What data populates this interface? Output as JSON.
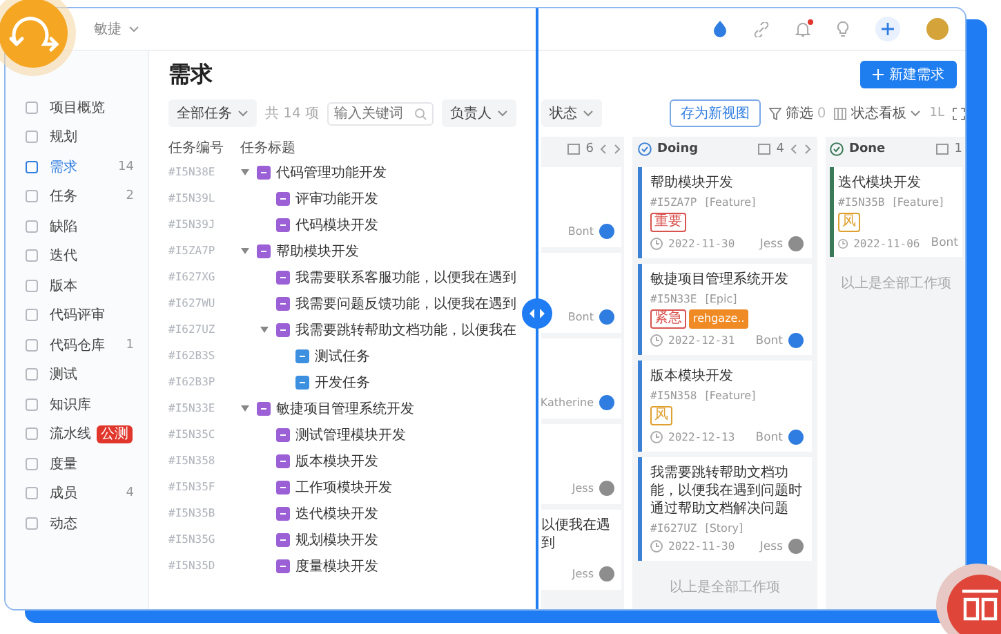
{
  "header": {
    "project": "敏捷",
    "notification": true
  },
  "sidebar": {
    "items": [
      {
        "label": "项目概览",
        "selected": false
      },
      {
        "label": "规划",
        "selected": false
      },
      {
        "label": "需求",
        "count": "14",
        "selected": true
      },
      {
        "label": "任务",
        "count": "2",
        "selected": false
      },
      {
        "label": "缺陷",
        "selected": false
      },
      {
        "label": "迭代",
        "selected": false
      },
      {
        "label": "版本",
        "selected": false
      },
      {
        "label": "代码评审",
        "selected": false
      },
      {
        "label": "代码仓库",
        "count": "1",
        "selected": false
      },
      {
        "label": "测试",
        "selected": false
      },
      {
        "label": "知识库",
        "selected": false
      },
      {
        "label": "流水线",
        "badge": "公测",
        "selected": false
      },
      {
        "label": "度量",
        "selected": false
      },
      {
        "label": "成员",
        "count": "4",
        "selected": false
      },
      {
        "label": "动态",
        "selected": false
      }
    ]
  },
  "page": {
    "title": "需求",
    "new_button": "新建需求"
  },
  "list_view": {
    "toolbar": {
      "scope": "全部任务",
      "total": "共 14 项",
      "search_placeholder": "输入关键词",
      "assignee": "负责人"
    },
    "columns": [
      "任务编号",
      "任务标题"
    ],
    "rows": [
      {
        "id": "#I5N38E",
        "title": "代码管理功能开发",
        "kind": "requirement",
        "expanded": true,
        "children": [
          {
            "id": "#I5N39L",
            "title": "评审功能开发",
            "kind": "requirement"
          },
          {
            "id": "#I5N39J",
            "title": "代码模块开发",
            "kind": "requirement"
          }
        ]
      },
      {
        "id": "#I5ZA7P",
        "title": "帮助模块开发",
        "kind": "requirement",
        "expanded": true,
        "children": [
          {
            "id": "#I627XG",
            "title": "我需要联系客服功能，以便我在遇到",
            "kind": "requirement"
          },
          {
            "id": "#I627WU",
            "title": "我需要问题反馈功能，以便我在遇到",
            "kind": "requirement"
          },
          {
            "id": "#I627UZ",
            "title": "我需要跳转帮助文档功能，以便我在",
            "kind": "requirement",
            "expanded": true,
            "children": [
              {
                "id": "#I62B3S",
                "title": "测试任务",
                "kind": "task"
              },
              {
                "id": "#I62B3P",
                "title": "开发任务",
                "kind": "task"
              }
            ]
          }
        ]
      },
      {
        "id": "#I5N33E",
        "title": "敏捷项目管理系统开发",
        "kind": "requirement",
        "expanded": true,
        "children": [
          {
            "id": "#I5N35C",
            "title": "测试管理模块开发",
            "kind": "requirement"
          },
          {
            "id": "#I5N358",
            "title": "版本模块开发",
            "kind": "requirement"
          },
          {
            "id": "#I5N35F",
            "title": "工作项模块开发",
            "kind": "requirement"
          },
          {
            "id": "#I5N35B",
            "title": "迭代模块开发",
            "kind": "requirement"
          },
          {
            "id": "#I5N35G",
            "title": "规划模块开发",
            "kind": "requirement"
          },
          {
            "id": "#I5N35D",
            "title": "度量模块开发",
            "kind": "requirement"
          }
        ]
      }
    ]
  },
  "board_view": {
    "toolbar": {
      "status": "状态",
      "save_view": "存为新视图",
      "filter": "筛选",
      "filter_count": "0",
      "view": "状态看板",
      "zoom": "1L"
    },
    "columns": [
      {
        "count": "6",
        "pager": true,
        "cards": [
          {
            "assignee": "Bont",
            "color": "#2f7de1"
          },
          {
            "assignee": "Bont",
            "color": "#2f7de1"
          },
          {
            "assignee": "Katherine",
            "color": "#2f7de1"
          },
          {
            "assignee": "Jess",
            "color": "#8d8d8d"
          },
          {
            "title": "以便我在遇到",
            "assignee": "Jess",
            "color": "#8d8d8d"
          }
        ]
      },
      {
        "name": "Doing",
        "count": "4",
        "pager": true,
        "color": "#3b82d6",
        "end_note": "以上是全部工作项",
        "cards": [
          {
            "title": "帮助模块开发",
            "id": "#I5ZA7P",
            "type": "[Feature]",
            "tags": [
              {
                "label": "重要",
                "kind": "outline",
                "color": "#d9534f"
              }
            ],
            "date": "2022-11-30",
            "assignee": "Jess",
            "color": "#8d8d8d"
          },
          {
            "title": "敏捷项目管理系统开发",
            "id": "#I5N33E",
            "type": "[Epic]",
            "tags": [
              {
                "label": "紧急",
                "kind": "outline",
                "color": "#d9534f"
              },
              {
                "label": "rehgaze..",
                "kind": "filled",
                "color": "#f08a24"
              }
            ],
            "date": "2022-12-31",
            "assignee": "Bont",
            "color": "#2f7de1"
          },
          {
            "title": "版本模块开发",
            "id": "#I5N358",
            "type": "[Feature]",
            "tags": [
              {
                "label": "风",
                "kind": "outline",
                "color": "#e0a030"
              }
            ],
            "date": "2022-12-13",
            "assignee": "Bont",
            "color": "#2f7de1"
          },
          {
            "title": "我需要跳转帮助文档功能，以便我在遇到问题时通过帮助文档解决问题",
            "id": "#I627UZ",
            "type": "[Story]",
            "date": "2022-11-30",
            "assignee": "Jess",
            "color": "#8d8d8d"
          }
        ]
      },
      {
        "name": "Done",
        "count": "1",
        "pager": false,
        "color": "#3a7a58",
        "end_note": "以上是全部工作项",
        "cards": [
          {
            "title": "迭代模块开发",
            "id": "#I5N35B",
            "type": "[Feature]",
            "tags": [
              {
                "label": "风",
                "kind": "outline",
                "color": "#e0a030"
              }
            ],
            "date": "2022-11-06",
            "assignee": "Bont"
          }
        ]
      }
    ]
  }
}
